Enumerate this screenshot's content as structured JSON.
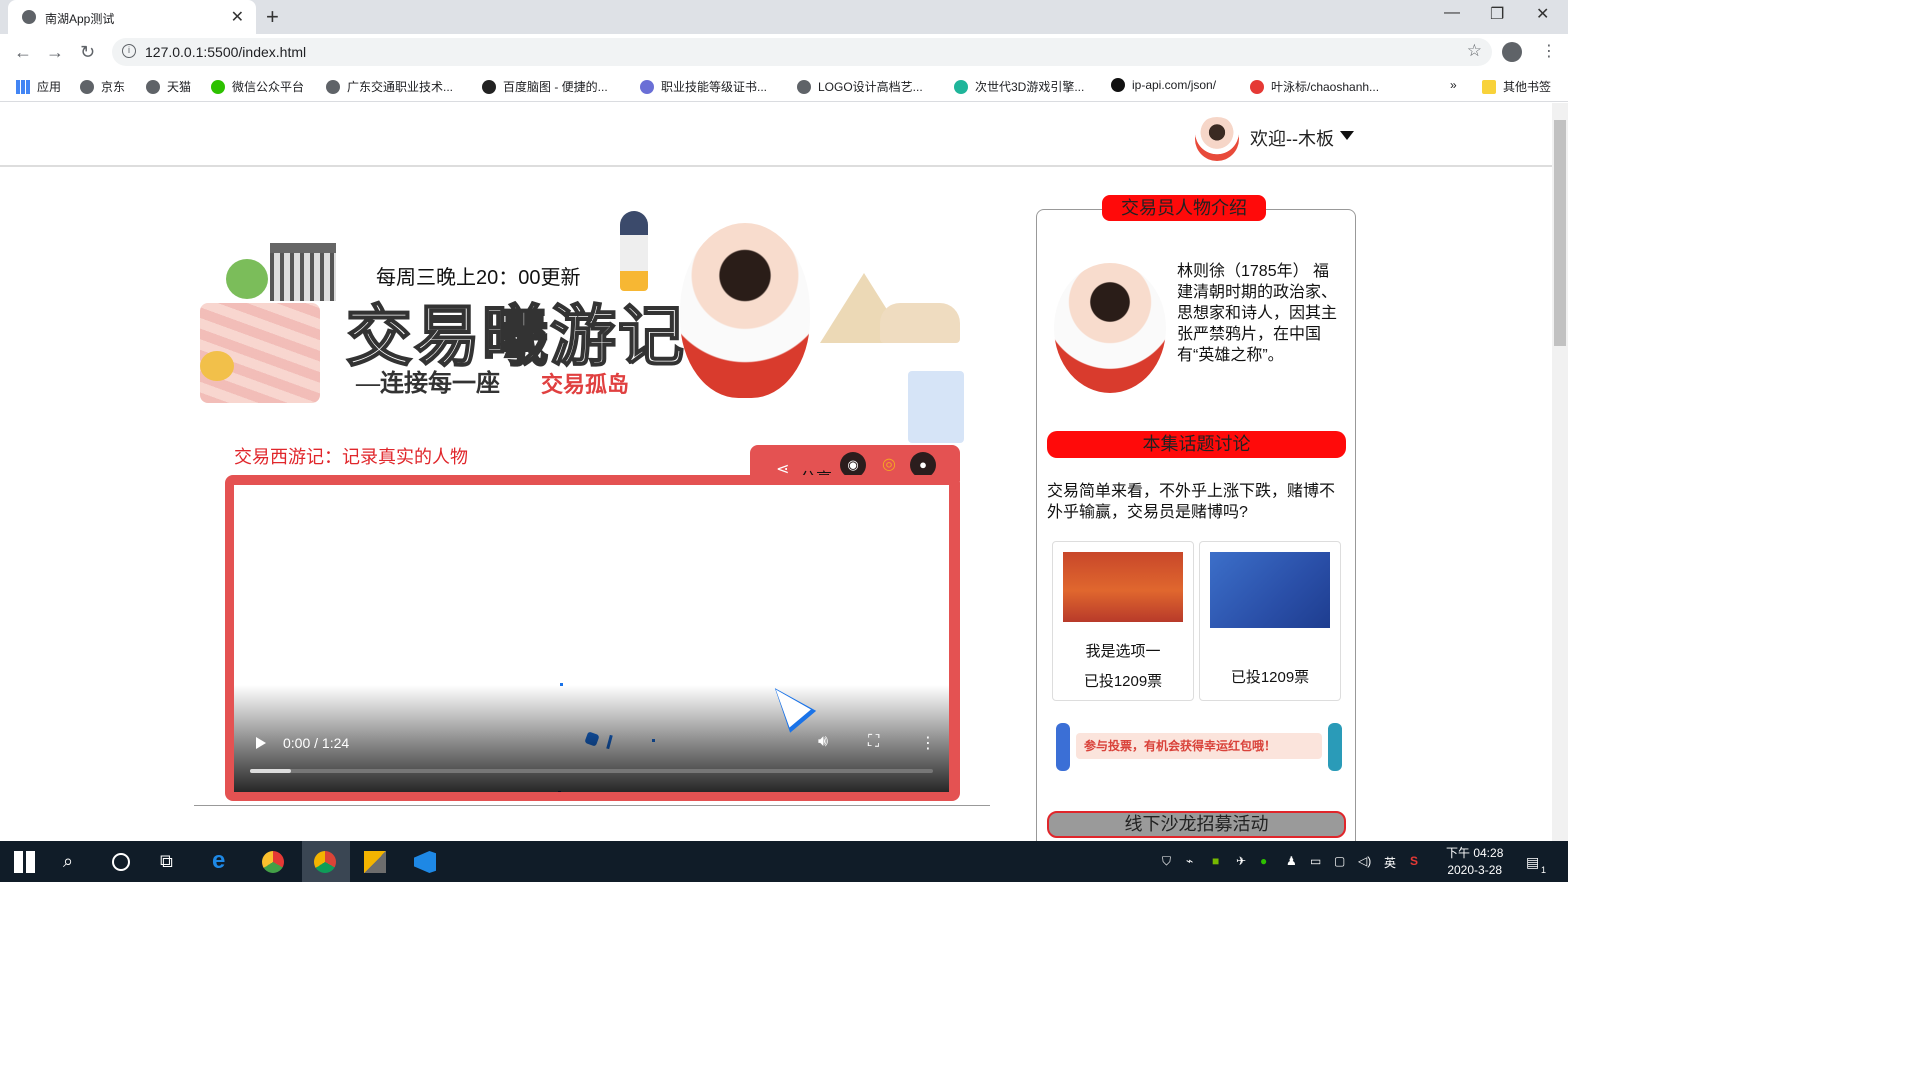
{
  "browser": {
    "tab_title": "南湖App测试",
    "url": "127.0.0.1:5500/index.html",
    "bookmarks": [
      "应用",
      "京东",
      "天猫",
      "微信公众平台",
      "广东交通职业技术...",
      "百度脑图 - 便捷的...",
      "职业技能等级证书...",
      "LOGO设计高档艺...",
      "次世代3D游戏引擎...",
      "ip-api.com/json/",
      "叶泳标/chaoshanh..."
    ],
    "more_bookmarks": "»",
    "other_bookmarks": "其他书签"
  },
  "page": {
    "header": {
      "welcome": "欢迎--木板"
    },
    "banner": {
      "update_text": "每周三晚上20：00更新",
      "title": "交易曦游记",
      "subtitle": "—连接每一座",
      "subtitle_red": "交易孤岛"
    },
    "video": {
      "caption": "交易西游记：记录真实的人物",
      "share_label": "分享",
      "time": "0:00 / 1:24",
      "progress": 0.06
    },
    "sidebar": {
      "intro_title": "交易员人物介绍",
      "bio": "林则徐（1785年） 福建清朝时期的政治家、思想家和诗人，因其主张严禁鸦片，在中国有“英雄之称”。",
      "discussion_title": "本集话题讨论",
      "question": "交易简单来看，不外乎上涨下跌，赌博不外乎输赢，交易员是赌博吗?",
      "vote_option_1": "我是选项一",
      "vote_count_1": "已投1209票",
      "vote_count_2": "已投1209票",
      "promo_text": "参与投票，有机会获得幸运红包哦！",
      "salon_title": "线下沙龙招募活动"
    }
  },
  "taskbar": {
    "ime": "英",
    "time": "下午 04:28",
    "date": "2020-3-28",
    "notifications": "1"
  },
  "colors": {
    "brand_red": "#e45252",
    "pill_red": "#ff0a0a",
    "caption_red": "#e0262b"
  }
}
